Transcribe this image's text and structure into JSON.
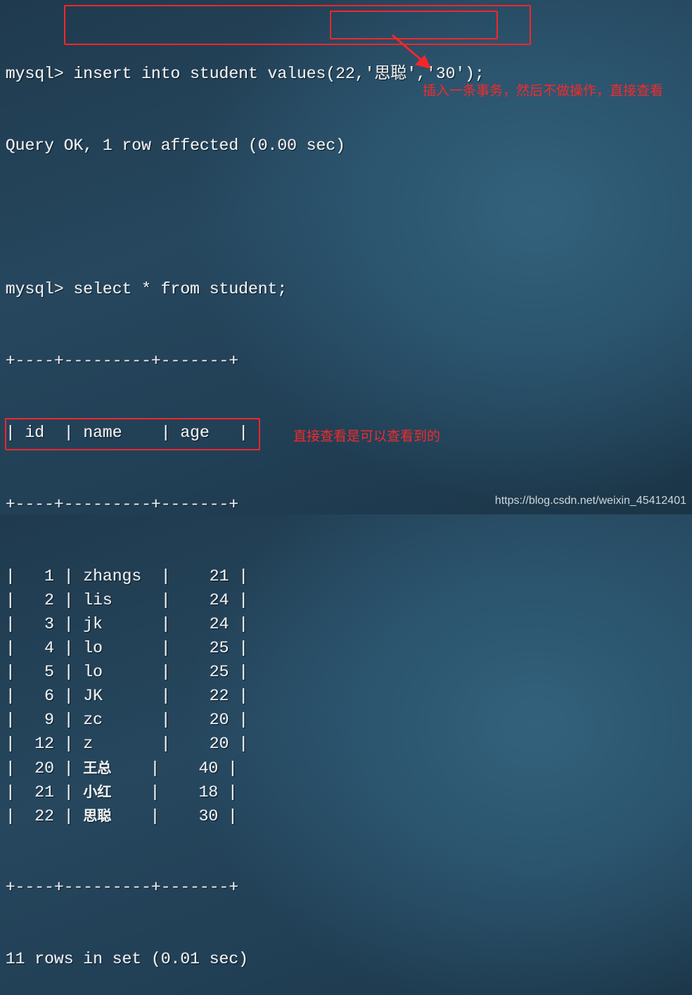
{
  "terminal": {
    "prompt": "mysql> ",
    "insert_command_prefix": "insert into student values",
    "insert_values": "(22,'思聪','30');",
    "insert_result": "Query OK, 1 row affected (0.00 sec)",
    "select_command": "select * from student;",
    "table": {
      "border": "+----+---------+-------+",
      "columns": [
        "id",
        "name",
        "age"
      ],
      "rows": [
        {
          "id": "1",
          "name": "zhangs",
          "age": "21"
        },
        {
          "id": "2",
          "name": "lis",
          "age": "24"
        },
        {
          "id": "3",
          "name": "jk",
          "age": "24"
        },
        {
          "id": "4",
          "name": "lo",
          "age": "25"
        },
        {
          "id": "5",
          "name": "lo",
          "age": "25"
        },
        {
          "id": "6",
          "name": "JK",
          "age": "22"
        },
        {
          "id": "9",
          "name": "zc",
          "age": "20"
        },
        {
          "id": "12",
          "name": "z",
          "age": "20"
        },
        {
          "id": "20",
          "name": "王总",
          "age": "40"
        },
        {
          "id": "21",
          "name": "小红",
          "age": "18"
        },
        {
          "id": "22",
          "name": "思聪",
          "age": "30"
        }
      ]
    },
    "select_result": "11 rows in set (0.01 sec)"
  },
  "annotations": {
    "insert_note": "插入一条事务，然后不做操作，直接查看",
    "result_note": "直接查看是可以查看到的",
    "highlight_color": "#f4262a"
  },
  "watermark": "https://blog.csdn.net/weixin_45412401"
}
